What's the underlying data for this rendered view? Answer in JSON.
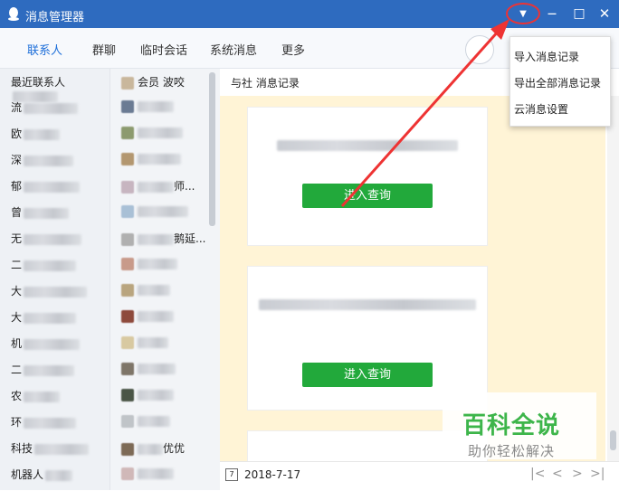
{
  "window": {
    "title": "消息管理器",
    "dropdown_glyph": "▼",
    "minimize_glyph": "—",
    "maximize_glyph": "□",
    "close_glyph": "✕"
  },
  "tabs": [
    "联系人",
    "群聊",
    "临时会话",
    "系统消息",
    "更多"
  ],
  "menu": {
    "items": [
      "导入消息记录",
      "导出全部消息记录",
      "云消息设置"
    ]
  },
  "categories": {
    "header": "最近联系人",
    "rows": [
      "流",
      "欧",
      "深",
      "郁",
      "曾",
      "无",
      "二",
      "大",
      "大",
      "机",
      "二",
      "农",
      "环",
      "科技",
      "机器人"
    ]
  },
  "contacts": {
    "header": "会员 波咬",
    "rows": [
      "",
      "",
      "",
      "师...",
      "",
      "鹅延...",
      "",
      "",
      "",
      "",
      "",
      "",
      "",
      "优优",
      ""
    ]
  },
  "pane": {
    "header": "与社 消息记录",
    "cards": [
      {
        "button": "进入查询"
      },
      {
        "button": "进入查询"
      }
    ],
    "footer_date": "2018-7-17",
    "calendar_glyph": "7"
  },
  "watermark": {
    "title": "百科全说",
    "subtitle": "助你轻松解决"
  },
  "colors": {
    "titlebar": "#2e6bbf",
    "accent": "#1e6fd9",
    "button_green": "#22a93b",
    "chat_bg": "#fff4d6",
    "annotation_red": "#e33"
  }
}
